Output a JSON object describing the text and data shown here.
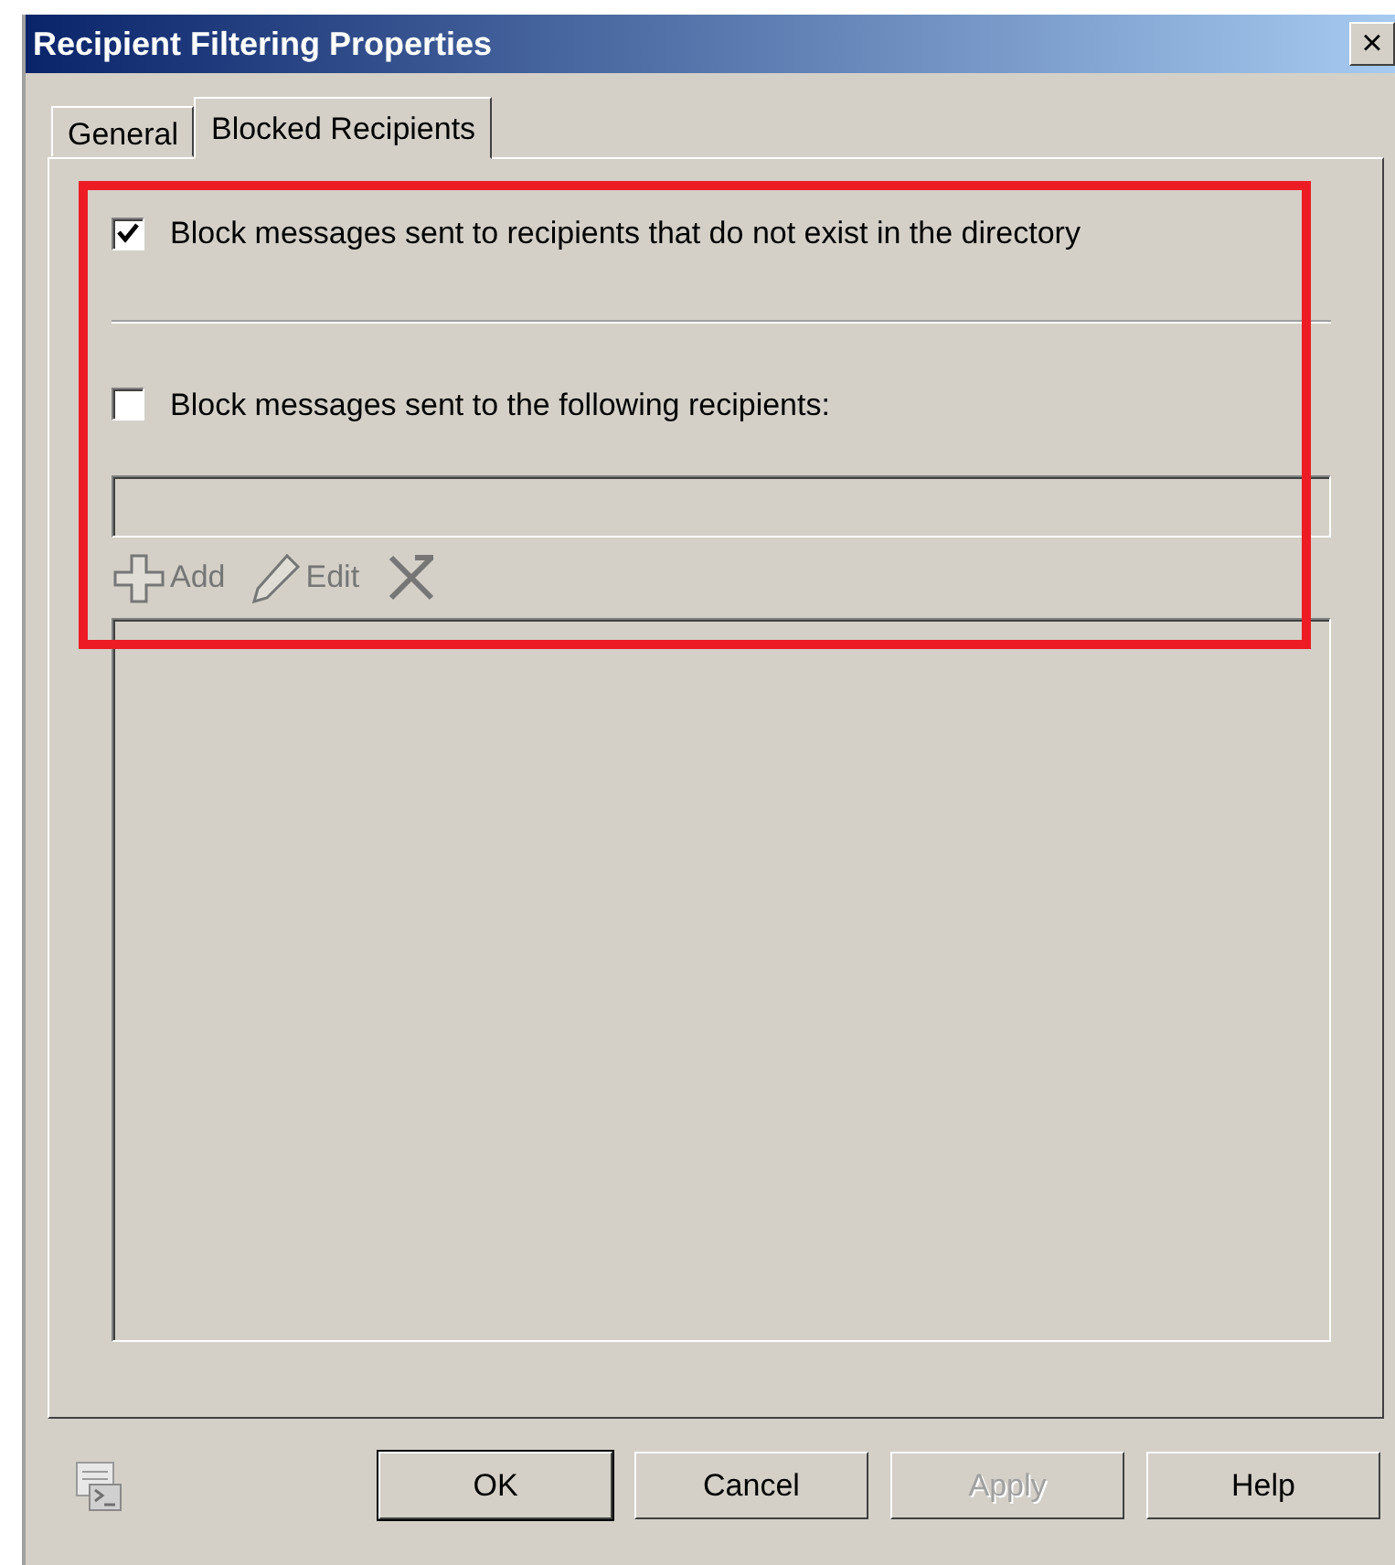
{
  "window": {
    "title": "Recipient Filtering Properties",
    "close": "×"
  },
  "tabs": [
    {
      "label": "General",
      "selected": false
    },
    {
      "label": "Blocked Recipients",
      "selected": true
    }
  ],
  "options": [
    {
      "kind": "checkbox",
      "label": "Block messages sent to recipients that do not exist in the directory",
      "checked": true
    },
    {
      "kind": "checkbox",
      "label": "Block messages sent to the following recipients:",
      "checked": false
    }
  ],
  "recipient_field": {
    "disabled": true
  },
  "toolbar": [
    {
      "kind": "add",
      "label": "Add",
      "disabled": true
    },
    {
      "kind": "edit",
      "label": "Edit",
      "disabled": true
    },
    {
      "kind": "delete",
      "disabled": true
    }
  ],
  "annotation": {
    "color": "#ed1c24"
  },
  "buttons": [
    {
      "label": "OK",
      "default": true,
      "disabled": false
    },
    {
      "label": "Cancel",
      "default": false,
      "disabled": false
    },
    {
      "label": "Apply",
      "default": false,
      "disabled": true
    },
    {
      "label": "Help",
      "default": false,
      "disabled": false
    }
  ]
}
